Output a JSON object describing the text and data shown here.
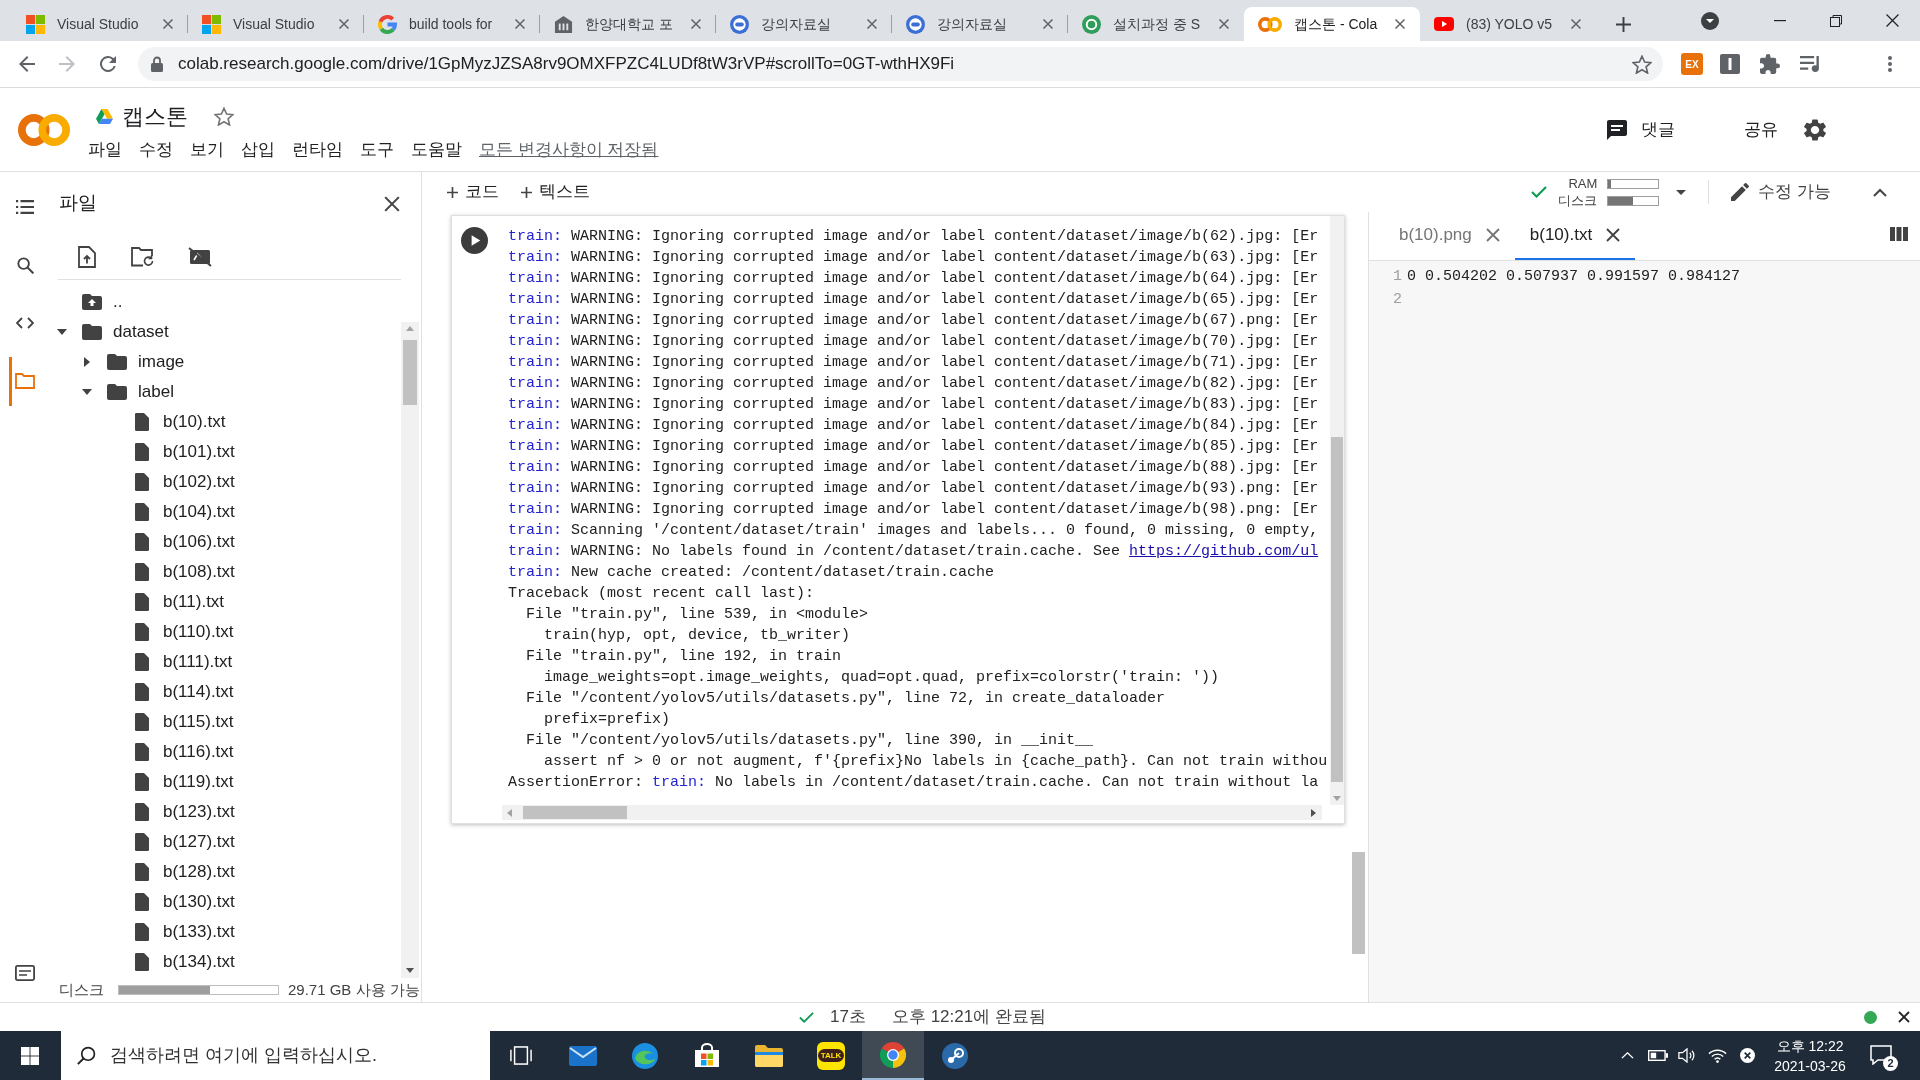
{
  "browser": {
    "tabs": [
      {
        "kind": "microsoft",
        "title": "Visual Studio",
        "selected": false
      },
      {
        "kind": "microsoft",
        "title": "Visual Studio",
        "selected": false
      },
      {
        "kind": "google",
        "title": "build tools for",
        "selected": false
      },
      {
        "kind": "building",
        "title": "한양대학교 포",
        "selected": false
      },
      {
        "kind": "circle",
        "title": "강의자료실",
        "selected": false
      },
      {
        "kind": "circle",
        "title": "강의자료실",
        "selected": false
      },
      {
        "kind": "sheet",
        "title": "설치과정 중 S",
        "selected": false
      },
      {
        "kind": "colab",
        "title": "캡스톤 - Cola",
        "selected": true
      },
      {
        "kind": "youtube",
        "title": "(83) YOLO v5",
        "selected": false
      }
    ],
    "address": {
      "value": "colab.research.google.com/drive/1GpMyzJZSA8rv9OMXFPZC4LUDf8tW3rVP#scrollTo=0GT-wthHX9Fi"
    },
    "extensions": [
      {
        "kind": "ex",
        "label": "EX"
      },
      {
        "kind": "info"
      },
      {
        "kind": "puzzle"
      },
      {
        "kind": "media"
      }
    ]
  },
  "notebook_header": {
    "title": "캡스톤",
    "starred": false,
    "menu": [
      "파일",
      "수정",
      "보기",
      "삽입",
      "런타임",
      "도구",
      "도움말"
    ],
    "save_status": "모든 변경사항이 저장됨",
    "comment": "댓글",
    "share": "공유"
  },
  "sidebar": {
    "title": "파일",
    "nav": [
      {
        "kind": "toc",
        "selected": false
      },
      {
        "kind": "search",
        "selected": false
      },
      {
        "kind": "code",
        "selected": false
      },
      {
        "kind": "files",
        "selected": true
      }
    ],
    "tree": [
      {
        "kind": "parent",
        "name": ".."
      },
      {
        "kind": "folder",
        "name": "dataset",
        "expanded": true,
        "children": [
          {
            "kind": "folder",
            "name": "image",
            "expanded": false
          },
          {
            "kind": "folder",
            "name": "label",
            "expanded": true,
            "children": [
              {
                "kind": "file",
                "name": "b(10).txt"
              },
              {
                "kind": "file",
                "name": "b(101).txt"
              },
              {
                "kind": "file",
                "name": "b(102).txt"
              },
              {
                "kind": "file",
                "name": "b(104).txt"
              },
              {
                "kind": "file",
                "name": "b(106).txt"
              },
              {
                "kind": "file",
                "name": "b(108).txt"
              },
              {
                "kind": "file",
                "name": "b(11).txt"
              },
              {
                "kind": "file",
                "name": "b(110).txt"
              },
              {
                "kind": "file",
                "name": "b(111).txt"
              },
              {
                "kind": "file",
                "name": "b(114).txt"
              },
              {
                "kind": "file",
                "name": "b(115).txt"
              },
              {
                "kind": "file",
                "name": "b(116).txt"
              },
              {
                "kind": "file",
                "name": "b(119).txt"
              },
              {
                "kind": "file",
                "name": "b(123).txt"
              },
              {
                "kind": "file",
                "name": "b(127).txt"
              },
              {
                "kind": "file",
                "name": "b(128).txt"
              },
              {
                "kind": "file",
                "name": "b(130).txt"
              },
              {
                "kind": "file",
                "name": "b(133).txt"
              },
              {
                "kind": "file",
                "name": "b(134).txt"
              }
            ]
          }
        ]
      }
    ],
    "disk": {
      "label": "디스크",
      "level": 0.57,
      "reading": "29.71 GB 사용 가능"
    }
  },
  "toolbar": {
    "add": [
      {
        "label": "코드"
      },
      {
        "label": "텍스트"
      }
    ],
    "connected": true,
    "meters": [
      {
        "label": "RAM",
        "level": 0.05
      },
      {
        "label": "디스크",
        "level": 0.5
      }
    ],
    "edit_mode": "수정 가능"
  },
  "output": {
    "lines": [
      [
        {
          "kind": "tag",
          "text": "train:"
        },
        {
          "kind": "plain",
          "text": " WARNING: Ignoring corrupted image and/or label content/dataset/image/b(62).jpg: [Er"
        }
      ],
      [
        {
          "kind": "tag",
          "text": "train:"
        },
        {
          "kind": "plain",
          "text": " WARNING: Ignoring corrupted image and/or label content/dataset/image/b(63).jpg: [Er"
        }
      ],
      [
        {
          "kind": "tag",
          "text": "train:"
        },
        {
          "kind": "plain",
          "text": " WARNING: Ignoring corrupted image and/or label content/dataset/image/b(64).jpg: [Er"
        }
      ],
      [
        {
          "kind": "tag",
          "text": "train:"
        },
        {
          "kind": "plain",
          "text": " WARNING: Ignoring corrupted image and/or label content/dataset/image/b(65).jpg: [Er"
        }
      ],
      [
        {
          "kind": "tag",
          "text": "train:"
        },
        {
          "kind": "plain",
          "text": " WARNING: Ignoring corrupted image and/or label content/dataset/image/b(67).png: [Er"
        }
      ],
      [
        {
          "kind": "tag",
          "text": "train:"
        },
        {
          "kind": "plain",
          "text": " WARNING: Ignoring corrupted image and/or label content/dataset/image/b(70).jpg: [Er"
        }
      ],
      [
        {
          "kind": "tag",
          "text": "train:"
        },
        {
          "kind": "plain",
          "text": " WARNING: Ignoring corrupted image and/or label content/dataset/image/b(71).jpg: [Er"
        }
      ],
      [
        {
          "kind": "tag",
          "text": "train:"
        },
        {
          "kind": "plain",
          "text": " WARNING: Ignoring corrupted image and/or label content/dataset/image/b(82).jpg: [Er"
        }
      ],
      [
        {
          "kind": "tag",
          "text": "train:"
        },
        {
          "kind": "plain",
          "text": " WARNING: Ignoring corrupted image and/or label content/dataset/image/b(83).jpg: [Er"
        }
      ],
      [
        {
          "kind": "tag",
          "text": "train:"
        },
        {
          "kind": "plain",
          "text": " WARNING: Ignoring corrupted image and/or label content/dataset/image/b(84).jpg: [Er"
        }
      ],
      [
        {
          "kind": "tag",
          "text": "train:"
        },
        {
          "kind": "plain",
          "text": " WARNING: Ignoring corrupted image and/or label content/dataset/image/b(85).jpg: [Er"
        }
      ],
      [
        {
          "kind": "tag",
          "text": "train:"
        },
        {
          "kind": "plain",
          "text": " WARNING: Ignoring corrupted image and/or label content/dataset/image/b(88).jpg: [Er"
        }
      ],
      [
        {
          "kind": "tag",
          "text": "train:"
        },
        {
          "kind": "plain",
          "text": " WARNING: Ignoring corrupted image and/or label content/dataset/image/b(93).png: [Er"
        }
      ],
      [
        {
          "kind": "tag",
          "text": "train:"
        },
        {
          "kind": "plain",
          "text": " WARNING: Ignoring corrupted image and/or label content/dataset/image/b(98).png: [Er"
        }
      ],
      [
        {
          "kind": "tag",
          "text": "train:"
        },
        {
          "kind": "plain",
          "text": " Scanning '/content/dataset/train' images and labels... 0 found, 0 missing, 0 empty,"
        }
      ],
      [
        {
          "kind": "tag",
          "text": "train:"
        },
        {
          "kind": "plain",
          "text": " WARNING: No labels found in /content/dataset/train.cache. See "
        },
        {
          "kind": "link",
          "text": "https://github.com/ul"
        }
      ],
      [
        {
          "kind": "tag",
          "text": "train:"
        },
        {
          "kind": "plain",
          "text": " New cache created: /content/dataset/train.cache"
        }
      ],
      [
        {
          "kind": "plain",
          "text": "Traceback (most recent call last):"
        }
      ],
      [
        {
          "kind": "plain",
          "text": "  File \"train.py\", line 539, in <module>"
        }
      ],
      [
        {
          "kind": "plain",
          "text": "    train(hyp, opt, device, tb_writer)"
        }
      ],
      [
        {
          "kind": "plain",
          "text": "  File \"train.py\", line 192, in train"
        }
      ],
      [
        {
          "kind": "plain",
          "text": "    image_weights=opt.image_weights, quad=opt.quad, prefix=colorstr('train: '))"
        }
      ],
      [
        {
          "kind": "plain",
          "text": "  File \"/content/yolov5/utils/datasets.py\", line 72, in create_dataloader"
        }
      ],
      [
        {
          "kind": "plain",
          "text": "    prefix=prefix)"
        }
      ],
      [
        {
          "kind": "plain",
          "text": "  File \"/content/yolov5/utils/datasets.py\", line 390, in __init__"
        }
      ],
      [
        {
          "kind": "plain",
          "text": "    assert nf > 0 or not augment, f'{prefix}No labels in {cache_path}. Can not train withou"
        }
      ],
      [
        {
          "kind": "plain",
          "text": "AssertionError: "
        },
        {
          "kind": "tag",
          "text": "train:"
        },
        {
          "kind": "plain",
          "text": " No labels in /content/dataset/train.cache. Can not train without la"
        }
      ]
    ]
  },
  "editor": {
    "tabs": [
      {
        "title": "b(10).png",
        "selected": false
      },
      {
        "title": "b(10).txt",
        "selected": true
      }
    ],
    "lines": [
      {
        "number": "1",
        "text": "0 0.504202 0.507937 0.991597 0.984127"
      },
      {
        "number": "2"
      }
    ]
  },
  "status_bar": {
    "elapsed": "17초",
    "completed": "오후 12:21에 완료됨",
    "connected": true
  },
  "taskbar": {
    "search": {
      "placeholder": "검색하려면 여기에 입력하십시오."
    },
    "apps": [
      {
        "kind": "taskview",
        "selected": false
      },
      {
        "kind": "mail",
        "selected": false
      },
      {
        "kind": "edge",
        "selected": false
      },
      {
        "kind": "store",
        "selected": false
      },
      {
        "kind": "explorer",
        "selected": false
      },
      {
        "kind": "kakao",
        "label": "TALK",
        "selected": false
      },
      {
        "kind": "chrome",
        "selected": true
      },
      {
        "kind": "steam",
        "selected": false
      }
    ],
    "clock": {
      "time": "오후 12:22",
      "date": "2021-03-26"
    },
    "notifications": "2"
  }
}
